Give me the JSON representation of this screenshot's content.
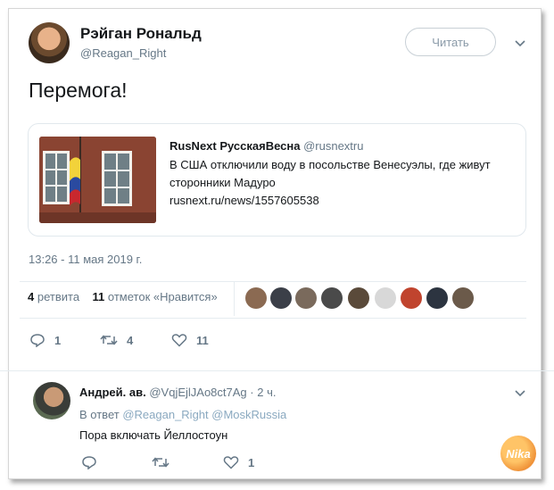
{
  "tweet": {
    "author_name": "Рэйган Рональд",
    "author_handle": "@Reagan_Right",
    "follow_label": "Читать",
    "text": "Перемога!",
    "timestamp": "13:26 - 11 мая 2019 г."
  },
  "card": {
    "source_name": "RusNext РусскаяВесна",
    "source_handle": "@rusnextru",
    "text": "В США отключили воду в посольстве Венесуэлы, где живут сторонники Мадуро",
    "link": "rusnext.ru/news/1557605538"
  },
  "stats": {
    "retweets_count": "4",
    "retweets_label": "ретвита",
    "likes_count": "11",
    "likes_label": "отметок «Нравится»"
  },
  "actions": {
    "reply_count": "1",
    "retweet_count": "4",
    "like_count": "11"
  },
  "reply": {
    "author_name": "Андрей. ав.",
    "author_handle": "@VqjEjlJAo8ct7Ag",
    "time": "· 2 ч.",
    "in_reply_prefix": "В ответ",
    "mentions": "@Reagan_Right @MoskRussia",
    "text": "Пора включать Йеллостоун",
    "reply_count": "",
    "retweet_count": "",
    "like_count": "1"
  },
  "watermark": "Nika",
  "colors": {
    "muted": "#657786",
    "border": "#e1e8ed",
    "watermark": "#f0943a"
  }
}
